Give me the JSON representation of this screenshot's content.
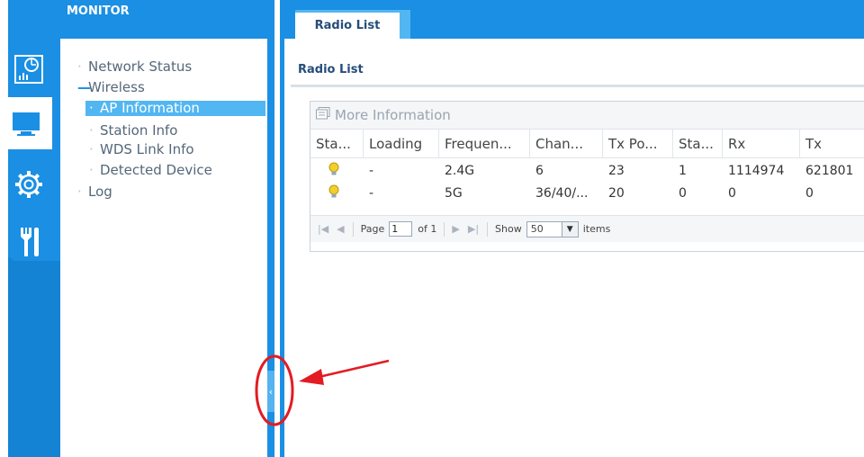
{
  "colors": {
    "primary": "#1a8fe3",
    "active_item": "#52b6f2",
    "title_text": "#254d7a",
    "annotation": "#e31b23",
    "bulb": "#e8c21a"
  },
  "rail": {
    "tabs": [
      {
        "icon": "dashboard-icon",
        "active": false
      },
      {
        "icon": "monitor-icon",
        "active": true
      },
      {
        "icon": "gear-icon",
        "active": false
      },
      {
        "icon": "tools-icon",
        "active": false
      }
    ]
  },
  "menu": {
    "title": "MONITOR",
    "items": [
      {
        "label": "Network Status",
        "prefix": "·",
        "level": 0
      },
      {
        "label": "Wireless",
        "prefix": "—",
        "level": 0,
        "expanded": true
      },
      {
        "label": "AP Information",
        "prefix": "·",
        "level": 1,
        "active": true
      },
      {
        "label": "Station Info",
        "prefix": "·",
        "level": 1
      },
      {
        "label": "WDS Link Info",
        "prefix": "·",
        "level": 1
      },
      {
        "label": "Detected Device",
        "prefix": "·",
        "level": 1
      },
      {
        "label": "Log",
        "prefix": "·",
        "level": 0
      }
    ]
  },
  "tab": {
    "label": "Radio List"
  },
  "section": {
    "title": "Radio List"
  },
  "toolbar": {
    "more_info": "More Information"
  },
  "table": {
    "columns": [
      "Sta...",
      "Loading",
      "Frequen...",
      "Chan...",
      "Tx Po...",
      "Sta...",
      "Rx",
      "Tx"
    ],
    "rows": [
      {
        "status": "bulb-icon",
        "loading": "-",
        "frequency": "2.4G",
        "channel": "6",
        "tx_power": "23",
        "stations": "1",
        "rx": "1114974",
        "tx": "621801"
      },
      {
        "status": "bulb-icon",
        "loading": "-",
        "frequency": "5G",
        "channel": "36/40/...",
        "tx_power": "20",
        "stations": "0",
        "rx": "0",
        "tx": "0"
      }
    ]
  },
  "pager": {
    "page_label": "Page",
    "page_value": "1",
    "of_label": "of 1",
    "show_label": "Show",
    "show_value": "50",
    "items_label": "items"
  }
}
